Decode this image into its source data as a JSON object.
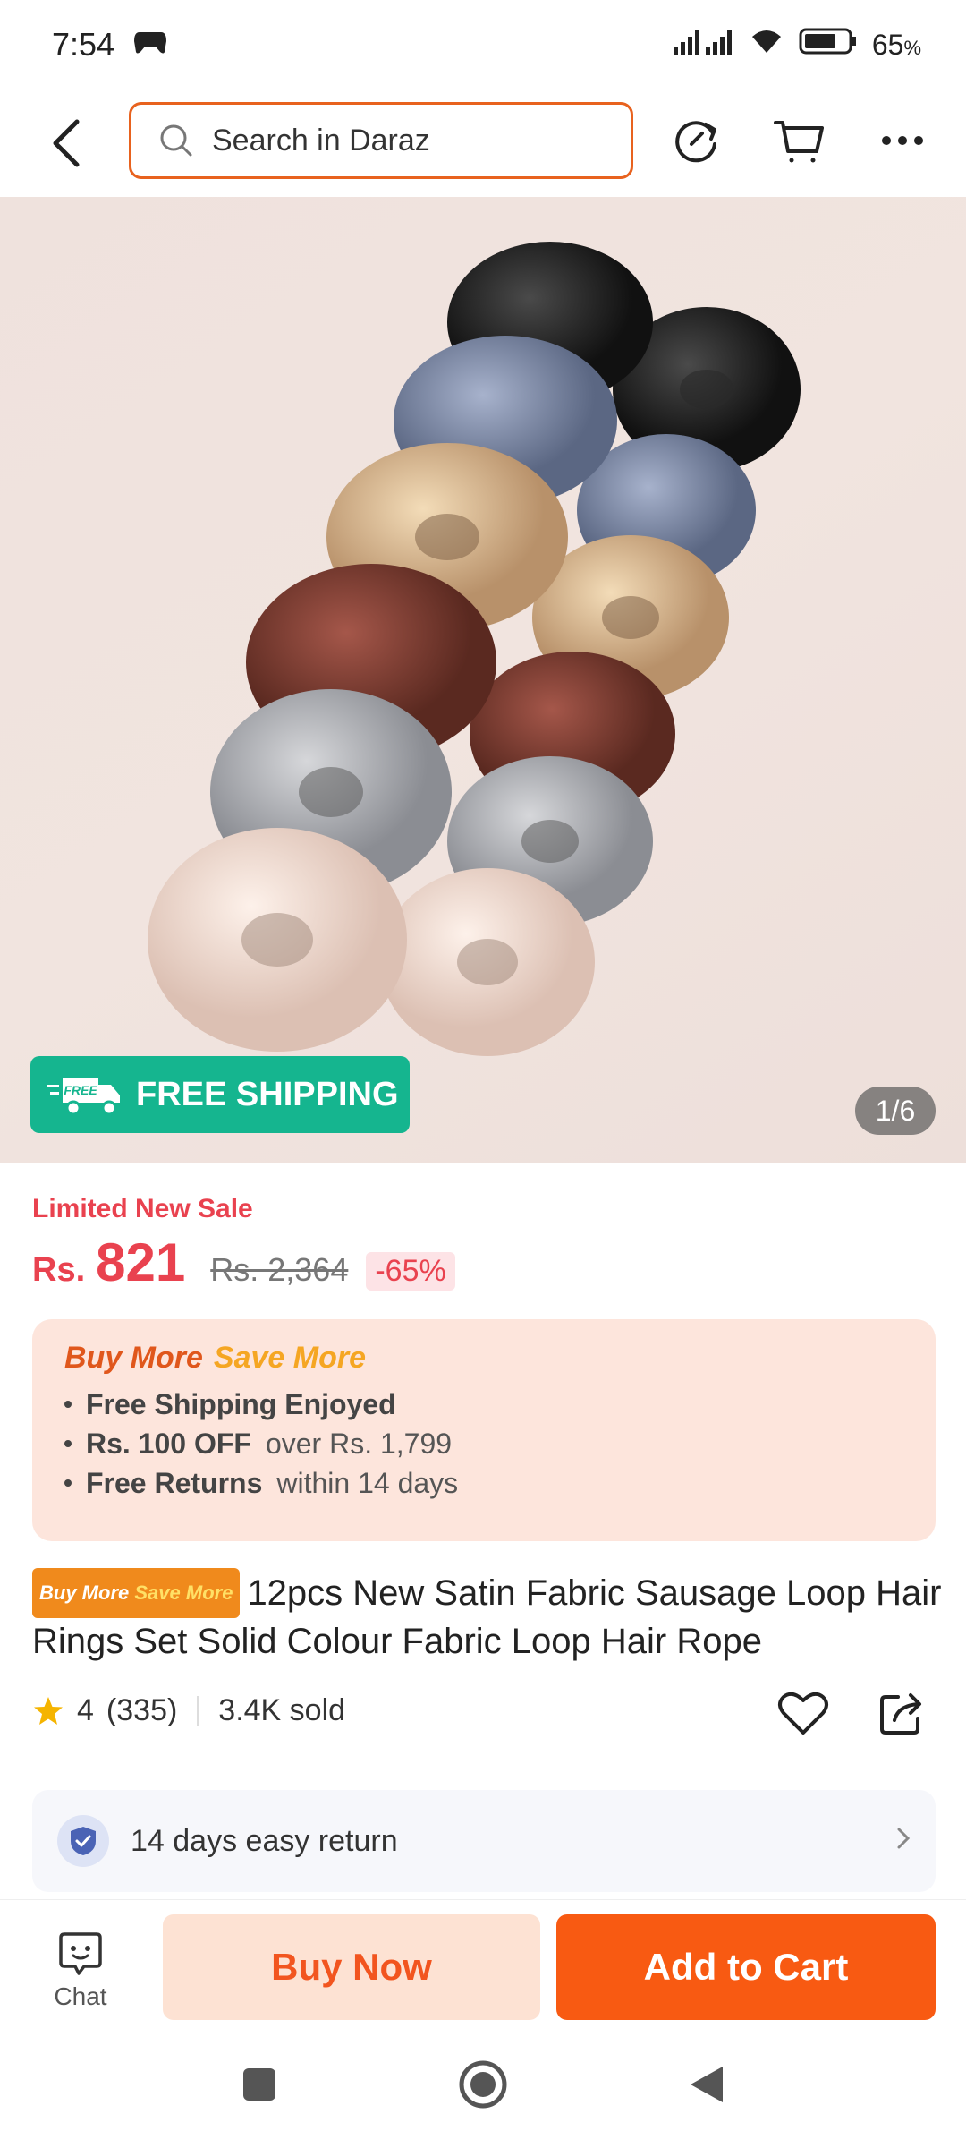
{
  "status_bar": {
    "time": "7:54",
    "battery": "65"
  },
  "header": {
    "search_placeholder": "Search in Daraz"
  },
  "image": {
    "badge_text": "FREE SHIPPING",
    "badge_icon_text": "FREE",
    "counter": "1/6"
  },
  "price": {
    "sale_label": "Limited New Sale",
    "currency": "Rs.",
    "current": "821",
    "original": "Rs. 2,364",
    "discount": "-65%"
  },
  "buy_more": {
    "title_a": "Buy More",
    "title_b": "Save More",
    "items": [
      {
        "bold": "Free Shipping Enjoyed",
        "rest": ""
      },
      {
        "bold": "Rs. 100 OFF",
        "rest": "over Rs. 1,799"
      },
      {
        "bold": "Free Returns",
        "rest": "within 14 days"
      }
    ]
  },
  "product": {
    "badge_a": "Buy More",
    "badge_b": "Save More",
    "title": "12pcs New Satin Fabric Sausage Loop Hair Rings Set Solid Colour Fabric Loop Hair Rope",
    "rating": "4",
    "reviews": "(335)",
    "sold": "3.4K sold"
  },
  "service": {
    "return_text": "14 days easy return"
  },
  "actions": {
    "chat": "Chat",
    "buy_now": "Buy Now",
    "add_to_cart": "Add to Cart"
  },
  "colors": {
    "accent": "#f85a12",
    "price": "#e9424f",
    "shipping": "#15b58f"
  }
}
